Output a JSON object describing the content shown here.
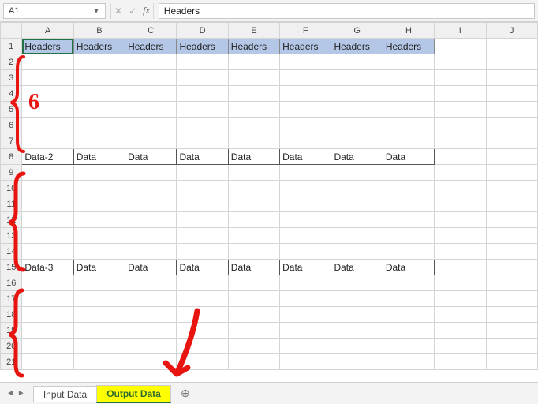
{
  "formula_bar": {
    "namebox_value": "A1",
    "cancel_icon": "✕",
    "enter_icon": "✓",
    "fx_label": "fx",
    "formula_value": "Headers"
  },
  "columns": [
    "A",
    "B",
    "C",
    "D",
    "E",
    "F",
    "G",
    "H",
    "I",
    "J"
  ],
  "rows": [
    "1",
    "2",
    "3",
    "4",
    "5",
    "6",
    "7",
    "8",
    "9",
    "10",
    "11",
    "12",
    "13",
    "14",
    "15",
    "16",
    "17",
    "18",
    "19",
    "20",
    "21"
  ],
  "cells": {
    "headers_row": {
      "row": "1",
      "values": [
        "Headers",
        "Headers",
        "Headers",
        "Headers",
        "Headers",
        "Headers",
        "Headers",
        "Headers"
      ]
    },
    "data_row_2": {
      "row": "8",
      "values": [
        "Data-2",
        "Data",
        "Data",
        "Data",
        "Data",
        "Data",
        "Data",
        "Data"
      ]
    },
    "data_row_3": {
      "row": "15",
      "values": [
        "Data-3",
        "Data",
        "Data",
        "Data",
        "Data",
        "Data",
        "Data",
        "Data"
      ]
    }
  },
  "annotations": {
    "brace_label": "6"
  },
  "tabs": {
    "input": "Input Data",
    "output": "Output Data"
  },
  "active_cell": "A1"
}
